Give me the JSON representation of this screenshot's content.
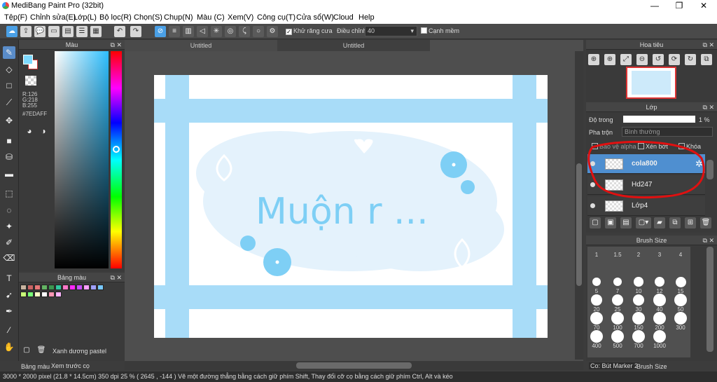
{
  "window": {
    "title": "MediBang Paint Pro (32bit)",
    "minimize": "—",
    "maximize": "❐",
    "close": "✕"
  },
  "menu": [
    "Tệp(F)",
    "Chỉnh sửa(E)",
    "Lớp(L)",
    "Bộ lọc(R)",
    "Chọn(S)",
    "Chụp(N)",
    "Màu (C)",
    "Xem(V)",
    "Công cụ(T)",
    "Cửa sổ(W)",
    "Cloud",
    "Help"
  ],
  "toolbar": {
    "antialias_label": "Khử răng cưa",
    "adjust_label": "Điều chỉnh",
    "adjust_value": "40",
    "edge_label": "Cạnh mềm"
  },
  "color_panel": {
    "title": "Màu",
    "r": "R:126",
    "g": "G:218",
    "b": "B:255",
    "hex": "#7EDAFF",
    "current_color": "#7EDAFF"
  },
  "palette_panel": {
    "title": "Bảng màu",
    "palette_name": "Xanh dương pastel",
    "colors": [
      "#c8b4a0",
      "#c86464",
      "#e87878",
      "#64b464",
      "#3c9650",
      "#32c8a0",
      "#ff78c8",
      "#ff28ff",
      "#c850ff",
      "#ffa0ff",
      "#a0a0ff",
      "#78c8ff",
      "#c8ff78",
      "#78ff78",
      "#ffffc8",
      "#ffffff",
      "#ff96b4",
      "#ffb4ff"
    ]
  },
  "bottom_tabs": {
    "left1": "Bảng màu",
    "left2": "Xem trước cọ",
    "right1": "Co: Bút Marker 2",
    "right2": "Brush Size"
  },
  "documents": {
    "tab1": "Untitled",
    "tab2": "Untitled"
  },
  "canvas": {
    "text": "Muộn r ..."
  },
  "navigator": {
    "title": "Hoa tiêu"
  },
  "layers": {
    "title": "Lớp",
    "opacity_label": "Độ trong",
    "opacity_value": "1 %",
    "blend_label": "Pha trộn",
    "blend_value": "Bình thường",
    "protect_alpha": "Bảo vệ alpha",
    "clip": "Xén bớt",
    "lock": "Khóa",
    "items": [
      {
        "name": "cola800"
      },
      {
        "name": "Hd247"
      },
      {
        "name": "Lớp4"
      }
    ]
  },
  "brush_size": {
    "title": "Brush Size",
    "sizes": [
      "1",
      "1.5",
      "2",
      "3",
      "4",
      "5",
      "7",
      "10",
      "12",
      "15",
      "20",
      "25",
      "30",
      "40",
      "50",
      "70",
      "100",
      "150",
      "200",
      "300",
      "400",
      "500",
      "700",
      "1000"
    ]
  },
  "status": {
    "text": "3000 * 2000 pixel  (21.8 * 14.5cm)  350 dpi  25 %  ( 2645 , -144 )  Vẽ một đường thẳng bằng cách giữ phím Shift, Thay đổi cỡ cọ bằng cách giữ phím Ctrl, Alt và kéo"
  }
}
